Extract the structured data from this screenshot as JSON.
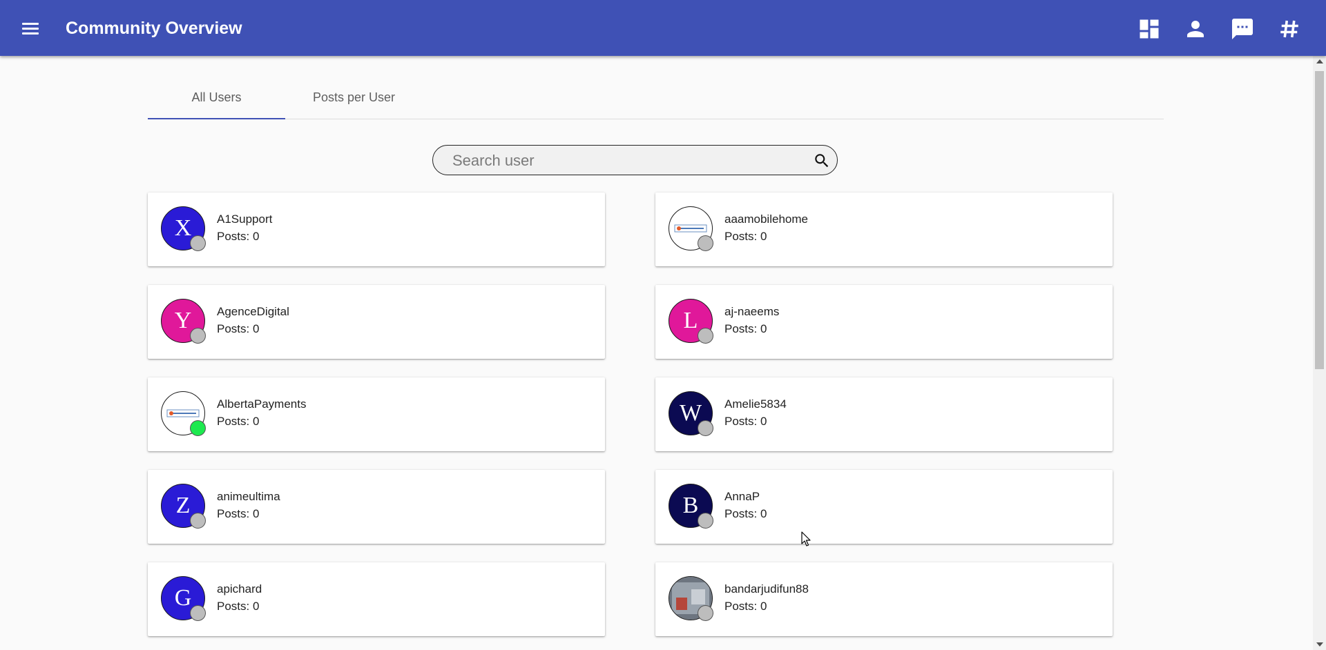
{
  "appbar": {
    "title": "Community Overview",
    "menu_icon": "hamburger-menu-icon",
    "actions": [
      {
        "name": "dashboard-icon"
      },
      {
        "name": "person-icon"
      },
      {
        "name": "chat-icon"
      },
      {
        "name": "hashtag-icon"
      }
    ]
  },
  "tabs": [
    {
      "label": "All Users",
      "active": true
    },
    {
      "label": "Posts per User",
      "active": false
    }
  ],
  "search": {
    "placeholder": "Search user",
    "value": "",
    "icon": "search-icon"
  },
  "colors": {
    "primary": "#3f51b5",
    "status_offline": "#bdbdbd",
    "status_online": "#1de94f"
  },
  "users": [
    {
      "name": "A1Support",
      "posts": "Posts: 0",
      "initial": "X",
      "avatar_color": "#2a1bd6",
      "avatar_type": "letter",
      "online": false
    },
    {
      "name": "aaamobilehome",
      "posts": "Posts: 0",
      "initial": "",
      "avatar_color": "#ffffff",
      "avatar_type": "image",
      "online": false
    },
    {
      "name": "AgenceDigital",
      "posts": "Posts: 0",
      "initial": "Y",
      "avatar_color": "#e0189a",
      "avatar_type": "letter",
      "online": false
    },
    {
      "name": "aj-naeems",
      "posts": "Posts: 0",
      "initial": "L",
      "avatar_color": "#e0189a",
      "avatar_type": "letter",
      "online": false
    },
    {
      "name": "AlbertaPayments",
      "posts": "Posts: 0",
      "initial": "",
      "avatar_color": "#ffffff",
      "avatar_type": "image",
      "online": true
    },
    {
      "name": "Amelie5834",
      "posts": "Posts: 0",
      "initial": "W",
      "avatar_color": "#0b0a52",
      "avatar_type": "letter",
      "online": false
    },
    {
      "name": "animeultima",
      "posts": "Posts: 0",
      "initial": "Z",
      "avatar_color": "#2a1bd6",
      "avatar_type": "letter",
      "online": false
    },
    {
      "name": "AnnaP",
      "posts": "Posts: 0",
      "initial": "B",
      "avatar_color": "#0b0a52",
      "avatar_type": "letter",
      "online": false
    },
    {
      "name": "apichard",
      "posts": "Posts: 0",
      "initial": "G",
      "avatar_color": "#2a1bd6",
      "avatar_type": "letter",
      "online": false
    },
    {
      "name": "bandarjudifun88",
      "posts": "Posts: 0",
      "initial": "",
      "avatar_color": "#8a8a8a",
      "avatar_type": "photo",
      "online": false
    }
  ]
}
